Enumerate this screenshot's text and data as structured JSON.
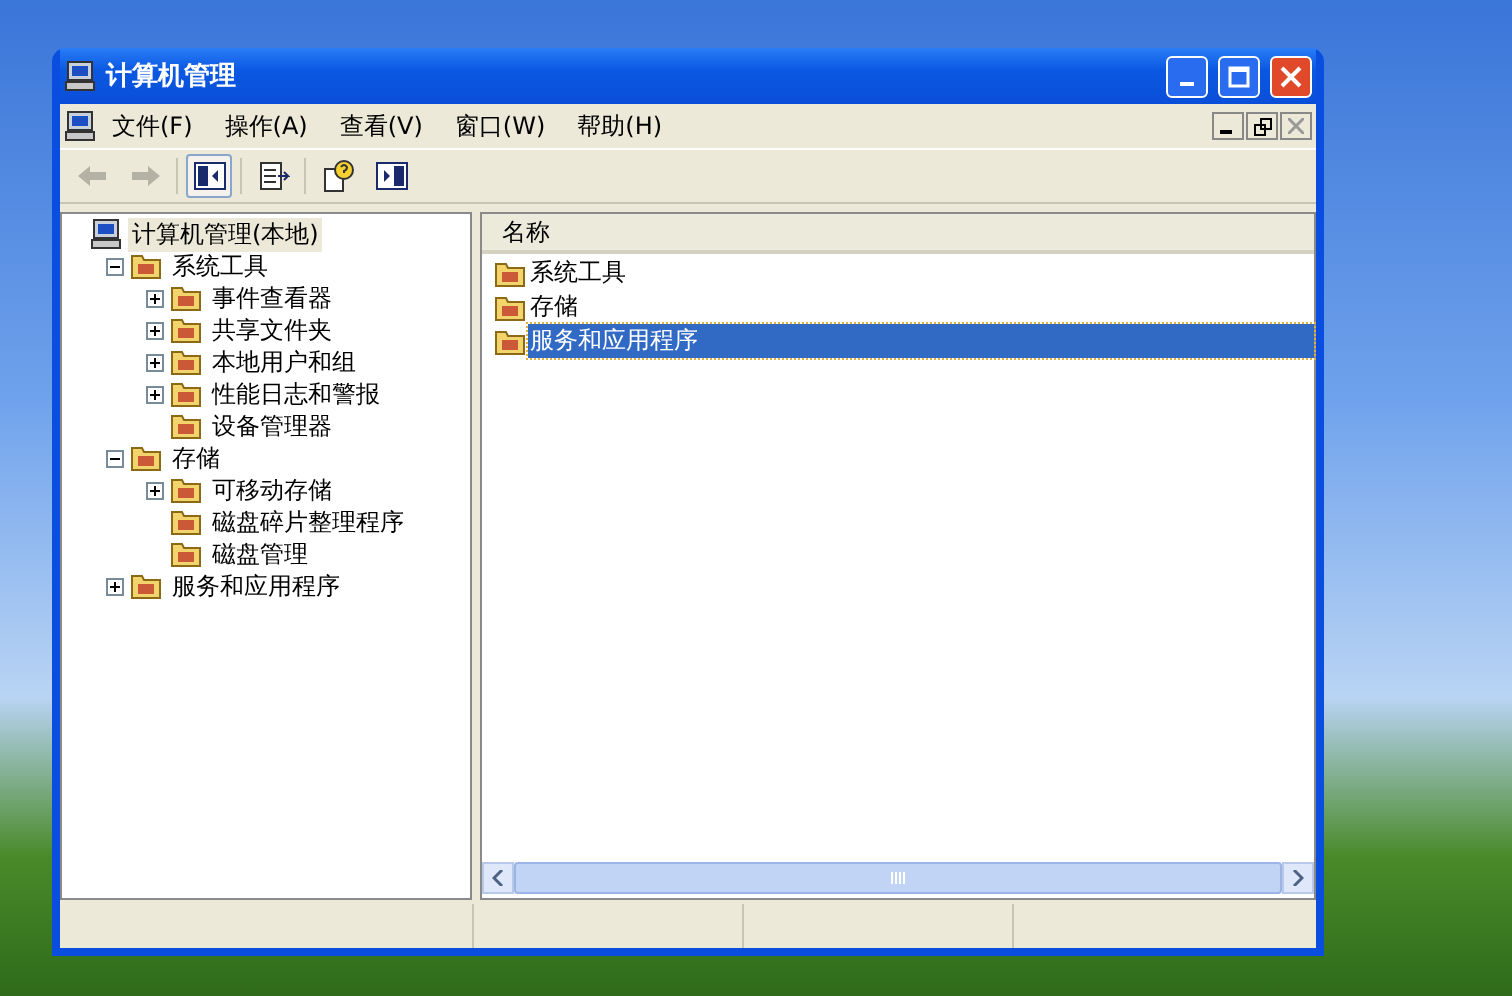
{
  "window": {
    "title": "计算机管理"
  },
  "menu": [
    "文件(F)",
    "操作(A)",
    "查看(V)",
    "窗口(W)",
    "帮助(H)"
  ],
  "tree": [
    {
      "label": "计算机管理(本地)",
      "selected": true,
      "children": [
        {
          "label": "系统工具",
          "expanded": true,
          "selected": false,
          "children": [
            {
              "label": "事件查看器",
              "expanded": false,
              "selected": false
            },
            {
              "label": "共享文件夹",
              "expanded": false,
              "selected": false
            },
            {
              "label": "本地用户和组",
              "expanded": false,
              "selected": false
            },
            {
              "label": "性能日志和警报",
              "expanded": false,
              "selected": false
            },
            {
              "label": "设备管理器",
              "selected": false
            }
          ]
        },
        {
          "label": "存储",
          "expanded": true,
          "selected": false,
          "children": [
            {
              "label": "可移动存储",
              "expanded": false,
              "selected": false
            },
            {
              "label": "磁盘碎片整理程序",
              "selected": false
            },
            {
              "label": "磁盘管理",
              "selected": false
            }
          ]
        },
        {
          "label": "服务和应用程序",
          "expanded": false,
          "selected": false
        }
      ]
    }
  ],
  "list": {
    "columns": [
      "名称"
    ],
    "rows": [
      {
        "name": "系统工具",
        "selected": false
      },
      {
        "name": "存储",
        "selected": false
      },
      {
        "name": "服务和应用程序",
        "selected": true
      }
    ]
  }
}
